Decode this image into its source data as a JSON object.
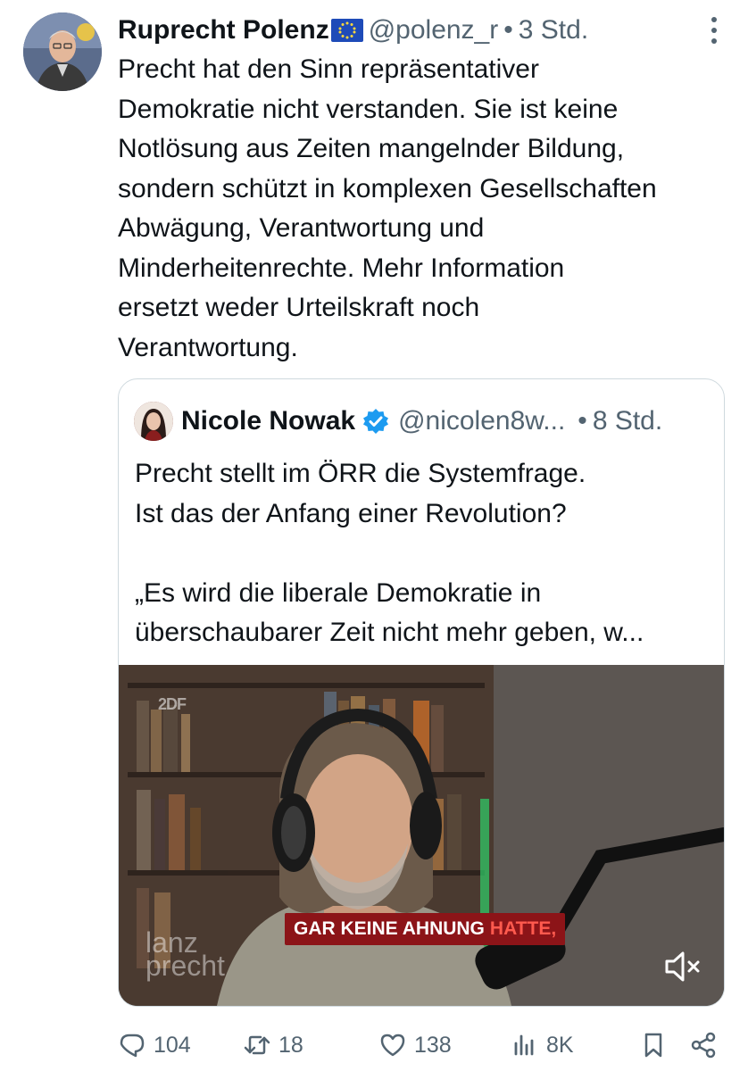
{
  "tweet": {
    "author_name": "Ruprecht Polenz",
    "author_handle": "@polenz_r",
    "separator": "•",
    "time": "3 Std.",
    "lines": [
      "Precht hat den Sinn repräsentativer",
      "Demokratie nicht verstanden. Sie ist keine",
      "Notlösung aus Zeiten mangelnder Bildung,",
      "sondern schützt in komplexen Gesellschaften",
      "Abwägung, Verantwortung und",
      "Minderheitenrechte. Mehr Information",
      "ersetzt weder Urteilskraft noch",
      "Verantwortung."
    ]
  },
  "quote": {
    "author_name": "Nicole Nowak",
    "author_handle": "@nicolen8w...",
    "separator": "•",
    "time": "8 Std.",
    "lines": [
      "Precht stellt im ÖRR die Systemfrage.",
      "Ist das der Anfang einer Revolution?",
      "",
      "„Es wird die liberale Demokratie in",
      "überschaubarer Zeit nicht mehr geben, w..."
    ],
    "video": {
      "channel_logo": "2DF",
      "subtitle_white": "GAR KEINE AHNUNG",
      "subtitle_highlight": "HATTE,",
      "watermark_line1": "lanz",
      "watermark_line2": "precht",
      "mute_icon": "speaker-muted-icon"
    }
  },
  "actions": {
    "replies": "104",
    "retweets": "18",
    "likes": "138",
    "views": "8K"
  },
  "colors": {
    "text": "#0f1419",
    "secondary": "#536471",
    "border": "#cfd9de",
    "verified": "#1d9bf0",
    "subtitle_bg": "#8c1418"
  }
}
